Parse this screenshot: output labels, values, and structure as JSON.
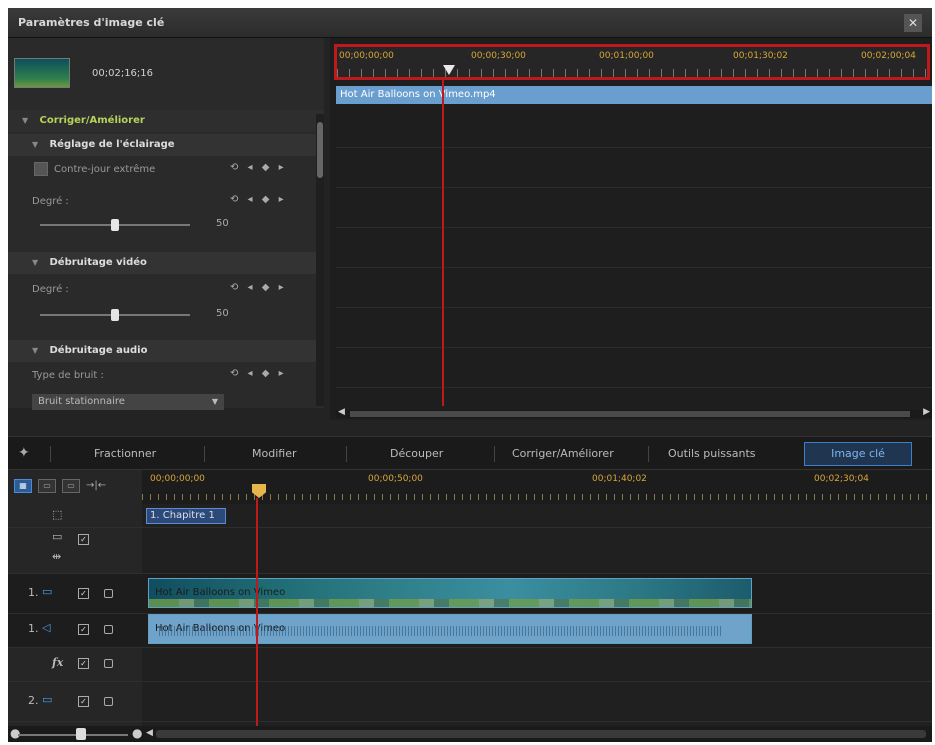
{
  "window": {
    "title": "Paramètres d'image clé",
    "close_glyph": "✕"
  },
  "left_panel": {
    "thumbnail_time": "00;02;16;16",
    "section_corriger": "Corriger/Améliorer",
    "sub_eclairage": "Réglage de l'éclairage",
    "contre_jour_label": "Contre-jour extrême",
    "degre_label_1": "Degré :",
    "degre_value_1": "50",
    "degre_level_1": 0.5,
    "sub_debruitage_video": "Débruitage vidéo",
    "degre_label_2": "Degré :",
    "degre_value_2": "50",
    "degre_level_2": 0.5,
    "sub_debruitage_audio": "Débruitage audio",
    "type_bruit_label": "Type de bruit :",
    "bruit_dropdown_value": "Bruit stationnaire"
  },
  "keyframe_area": {
    "ruler_labels": [
      "00;00;00;00",
      "00;00;30;00",
      "00;01;00;00",
      "00;01;30;02",
      "00;02;00;04"
    ],
    "clip_name": "Hot Air Balloons on Vimeo.mp4"
  },
  "toolbar": {
    "items": [
      "Fractionner",
      "Modifier",
      "Découper",
      "Corriger/Améliorer",
      "Outils puissants"
    ],
    "active": "Image clé"
  },
  "timeline": {
    "ruler_labels": [
      "00;00;00;00",
      "00;00;50;00",
      "00;01;40;02",
      "00;02;30;04"
    ],
    "chapter_label": "1. Chapitre 1",
    "video_track_index": "1.",
    "audio_track_index": "1.",
    "video2_track_index": "2.",
    "video_clip_name": "Hot Air Balloons on Vimeo",
    "audio_clip_name": "Hot Air Balloons on Vimeo",
    "fx_label": "fx"
  },
  "colors": {
    "highlight_red": "#c0191c",
    "ruler_text": "#d9a63a",
    "active_tab": "#3f7fc8",
    "clip_blue": "#6a9ecf"
  }
}
